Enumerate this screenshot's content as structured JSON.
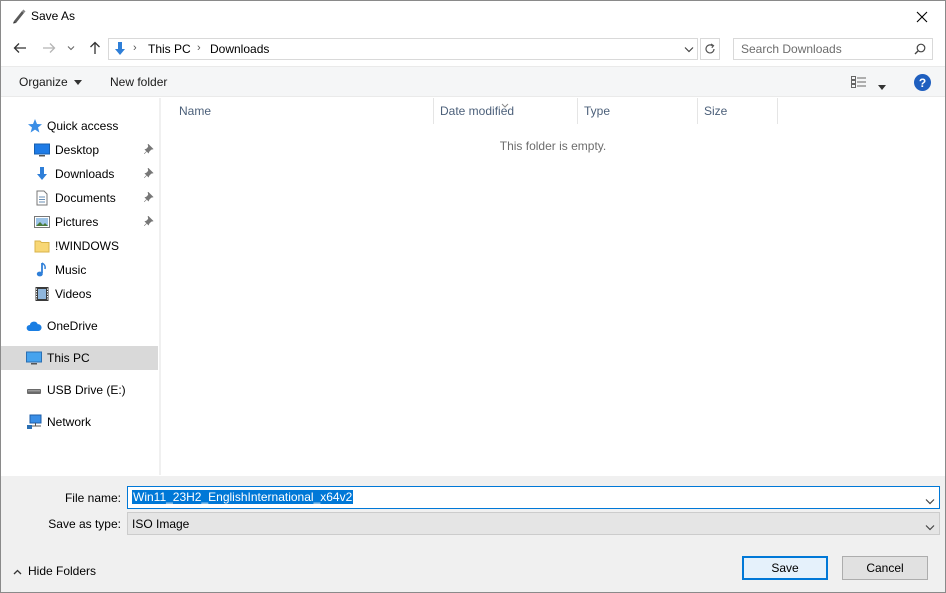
{
  "window": {
    "title": "Save As"
  },
  "address": {
    "crumbs": [
      "This PC",
      "Downloads"
    ],
    "search_placeholder": "Search Downloads"
  },
  "toolbar": {
    "organize": "Organize",
    "new_folder": "New folder"
  },
  "nav": {
    "items": [
      {
        "label": "Quick access",
        "icon": "star-icon"
      },
      {
        "label": "Desktop",
        "icon": "desktop-icon",
        "pinned": true
      },
      {
        "label": "Downloads",
        "icon": "download-arrow-icon",
        "pinned": true
      },
      {
        "label": "Documents",
        "icon": "documents-icon",
        "pinned": true
      },
      {
        "label": "Pictures",
        "icon": "pictures-icon",
        "pinned": true
      },
      {
        "label": "!WINDOWS",
        "icon": "folder-icon"
      },
      {
        "label": "Music",
        "icon": "music-icon"
      },
      {
        "label": "Videos",
        "icon": "videos-icon"
      },
      {
        "label": "OneDrive",
        "icon": "cloud-icon"
      },
      {
        "label": "This PC",
        "icon": "computer-icon",
        "selected": true
      },
      {
        "label": "USB Drive (E:)",
        "icon": "usb-drive-icon"
      },
      {
        "label": "Network",
        "icon": "network-icon"
      }
    ]
  },
  "content": {
    "columns": [
      "Name",
      "Date modified",
      "Type",
      "Size"
    ],
    "empty_message": "This folder is empty."
  },
  "save": {
    "file_name_label": "File name:",
    "file_name_value": "Win11_23H2_EnglishInternational_x64v2",
    "save_type_label": "Save as type:",
    "save_type_value": "ISO Image",
    "hide_folders": "Hide Folders",
    "save_button": "Save",
    "cancel_button": "Cancel"
  },
  "colors": {
    "accent": "#0078d7",
    "selected_nav": "#d9d9d9"
  }
}
